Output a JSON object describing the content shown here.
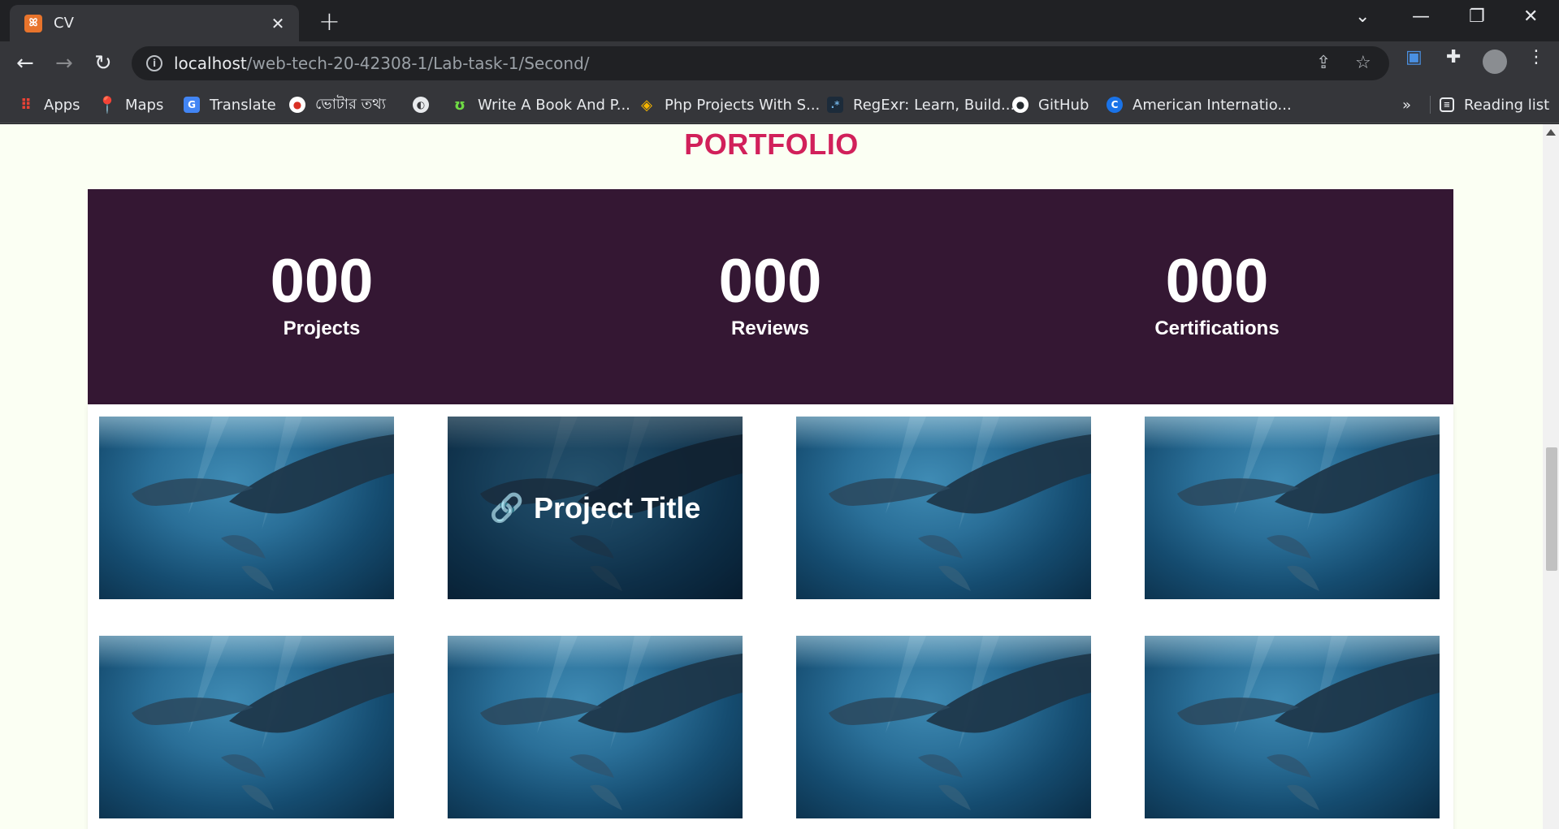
{
  "browser": {
    "tab_title": "CV",
    "tab_favicon": "xampp-icon",
    "new_tab_label": "+",
    "url_host": "localhost",
    "url_path": "/web-tech-20-42308-1/Lab-task-1/Second/"
  },
  "bookmarks": {
    "items": [
      {
        "label": "Apps",
        "icon": "apps-grid-icon",
        "color": "#4285f4"
      },
      {
        "label": "Maps",
        "icon": "maps-pin-icon",
        "color": "#34a853"
      },
      {
        "label": "Translate",
        "icon": "translate-icon",
        "color": "#4285f4"
      },
      {
        "label": "ভোটার তথ্য",
        "icon": "election-commission-icon",
        "color": "#d93025"
      },
      {
        "label": "",
        "icon": "globe-icon",
        "color": "#e8eaed"
      },
      {
        "label": "Write A Book And P...",
        "icon": "upwork-icon",
        "color": "#6fda44"
      },
      {
        "label": "Php Projects With S...",
        "icon": "php-projects-icon",
        "color": "#f4b400"
      },
      {
        "label": "RegExr: Learn, Build...",
        "icon": "regexr-icon",
        "color": "#70b0e0"
      },
      {
        "label": "GitHub",
        "icon": "github-icon",
        "color": "#ffffff"
      },
      {
        "label": "American Internatio...",
        "icon": "aiub-icon",
        "color": "#1a73e8"
      }
    ],
    "overflow_label": "»",
    "reading_list_label": "Reading list"
  },
  "page": {
    "section_title": "PORTFOLIO",
    "stats": [
      {
        "number": "000",
        "label": "Projects"
      },
      {
        "number": "000",
        "label": "Reviews"
      },
      {
        "number": "000",
        "label": "Certifications"
      }
    ],
    "gallery": {
      "hovered_index": 1,
      "hover_title": "Project Title",
      "hover_icon": "link-icon",
      "image_subject": "dolphins-underwater"
    }
  },
  "colors": {
    "page_bg": "#fbfff3",
    "accent": "#d1205a",
    "stats_bg": "#341733"
  }
}
